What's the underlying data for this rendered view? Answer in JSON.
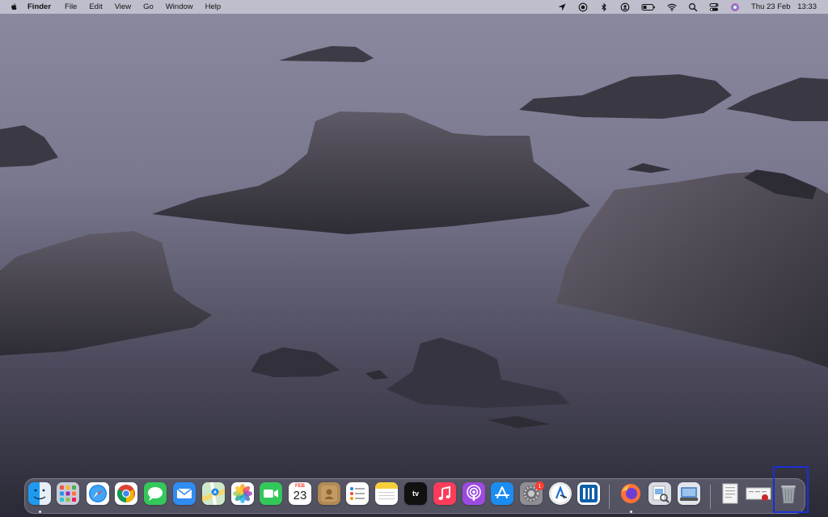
{
  "menubar": {
    "app_name": "Finder",
    "menus": [
      "File",
      "Edit",
      "View",
      "Go",
      "Window",
      "Help"
    ],
    "status_icons": [
      "location-icon",
      "screen-record-icon",
      "bluetooth-icon",
      "user-icon",
      "battery-icon",
      "wifi-icon",
      "spotlight-search-icon",
      "control-center-icon",
      "siri-icon"
    ],
    "clock": {
      "date": "Thu 23 Feb",
      "time": "13:33"
    }
  },
  "dock": {
    "apps": [
      {
        "name": "Finder",
        "icon": "finder-icon",
        "running": true
      },
      {
        "name": "Launchpad",
        "icon": "launchpad-icon"
      },
      {
        "name": "Safari",
        "icon": "safari-icon"
      },
      {
        "name": "Google Chrome",
        "icon": "chrome-icon"
      },
      {
        "name": "Messages",
        "icon": "messages-icon"
      },
      {
        "name": "Mail",
        "icon": "mail-icon"
      },
      {
        "name": "Maps",
        "icon": "maps-icon"
      },
      {
        "name": "Photos",
        "icon": "photos-icon"
      },
      {
        "name": "FaceTime",
        "icon": "facetime-icon"
      },
      {
        "name": "Calendar",
        "icon": "calendar-icon",
        "month": "FEB",
        "day": "23"
      },
      {
        "name": "Contacts",
        "icon": "contacts-icon"
      },
      {
        "name": "Reminders",
        "icon": "reminders-icon"
      },
      {
        "name": "Notes",
        "icon": "notes-icon"
      },
      {
        "name": "TV",
        "icon": "apple-tv-icon",
        "label": "tv"
      },
      {
        "name": "Music",
        "icon": "music-icon"
      },
      {
        "name": "Podcasts",
        "icon": "podcasts-icon"
      },
      {
        "name": "App Store",
        "icon": "app-store-icon"
      },
      {
        "name": "System Preferences",
        "icon": "system-preferences-icon",
        "badge": "1"
      },
      {
        "name": "Xcode Instruments",
        "icon": "instruments-icon"
      },
      {
        "name": "Parallels",
        "icon": "parallels-icon"
      },
      {
        "name": "Firefox",
        "icon": "firefox-icon",
        "running": true
      },
      {
        "name": "Preview",
        "icon": "preview-icon"
      },
      {
        "name": "Image Capture",
        "icon": "image-capture-icon"
      }
    ],
    "stacks": [
      {
        "name": "Documents",
        "icon": "documents-stack-icon"
      },
      {
        "name": "Downloads",
        "icon": "downloads-stack-icon"
      }
    ],
    "trash": {
      "name": "Trash",
      "icon": "trash-icon"
    }
  },
  "colors": {
    "highlight": "#1a2fd6",
    "badge": "#ff3b30"
  }
}
